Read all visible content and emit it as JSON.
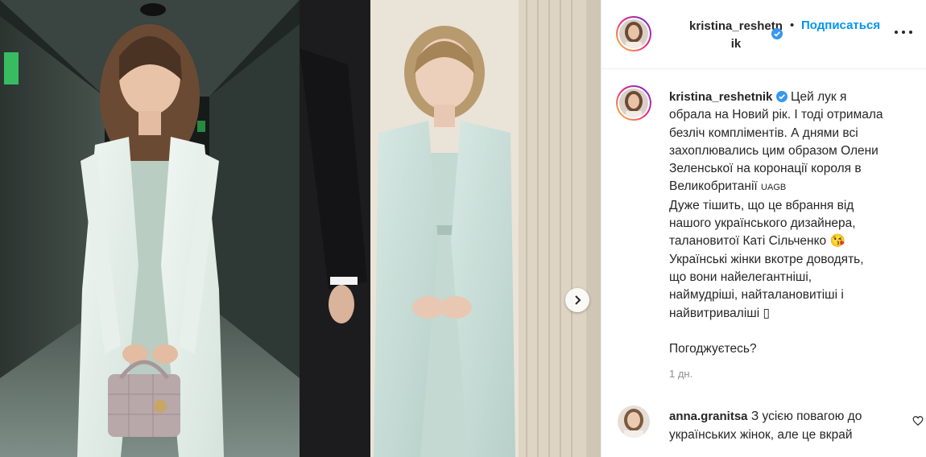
{
  "header": {
    "username_line1": "kristina_reshetn",
    "username_line2": "ik",
    "separator": "•",
    "follow_label": "Подписаться"
  },
  "caption": {
    "username": "kristina_reshetnik",
    "text_lines": [
      "Цей лук я",
      "обрала на Новий рік. І тоді отримала",
      "безліч компліментів. А днями всі",
      "захоплювались цим образом Олени",
      "Зеленської на коронації короля в",
      "Великобританії"
    ],
    "tag": "UAGB",
    "text_lines_2": [
      "Дуже тішить, що це вбрання від",
      "нашого українського дизайнера,",
      "талановитої Каті Сільченко"
    ],
    "emoji": "😘",
    "text_lines_3": [
      "Українські жінки вкотре доводять,",
      "що вони найелегантніші,",
      "наймудріші, найталановитіші і",
      "найвитриваліші"
    ],
    "box_glyph": "▯",
    "question": "Погоджуєтесь?",
    "time": "1 дн."
  },
  "comment": {
    "username": "anna.granitsa",
    "text_line1": "З усією повагою до",
    "text_line2": "українських жінок, але це вкрай"
  },
  "icons": {
    "verified": "verified-badge-icon",
    "more": "more-options-icon",
    "next": "chevron-right-icon",
    "like": "heart-icon"
  },
  "colors": {
    "link_blue": "#0095f6",
    "verified_blue": "#3897f0",
    "text": "#262626",
    "muted": "#8e8e8e"
  }
}
